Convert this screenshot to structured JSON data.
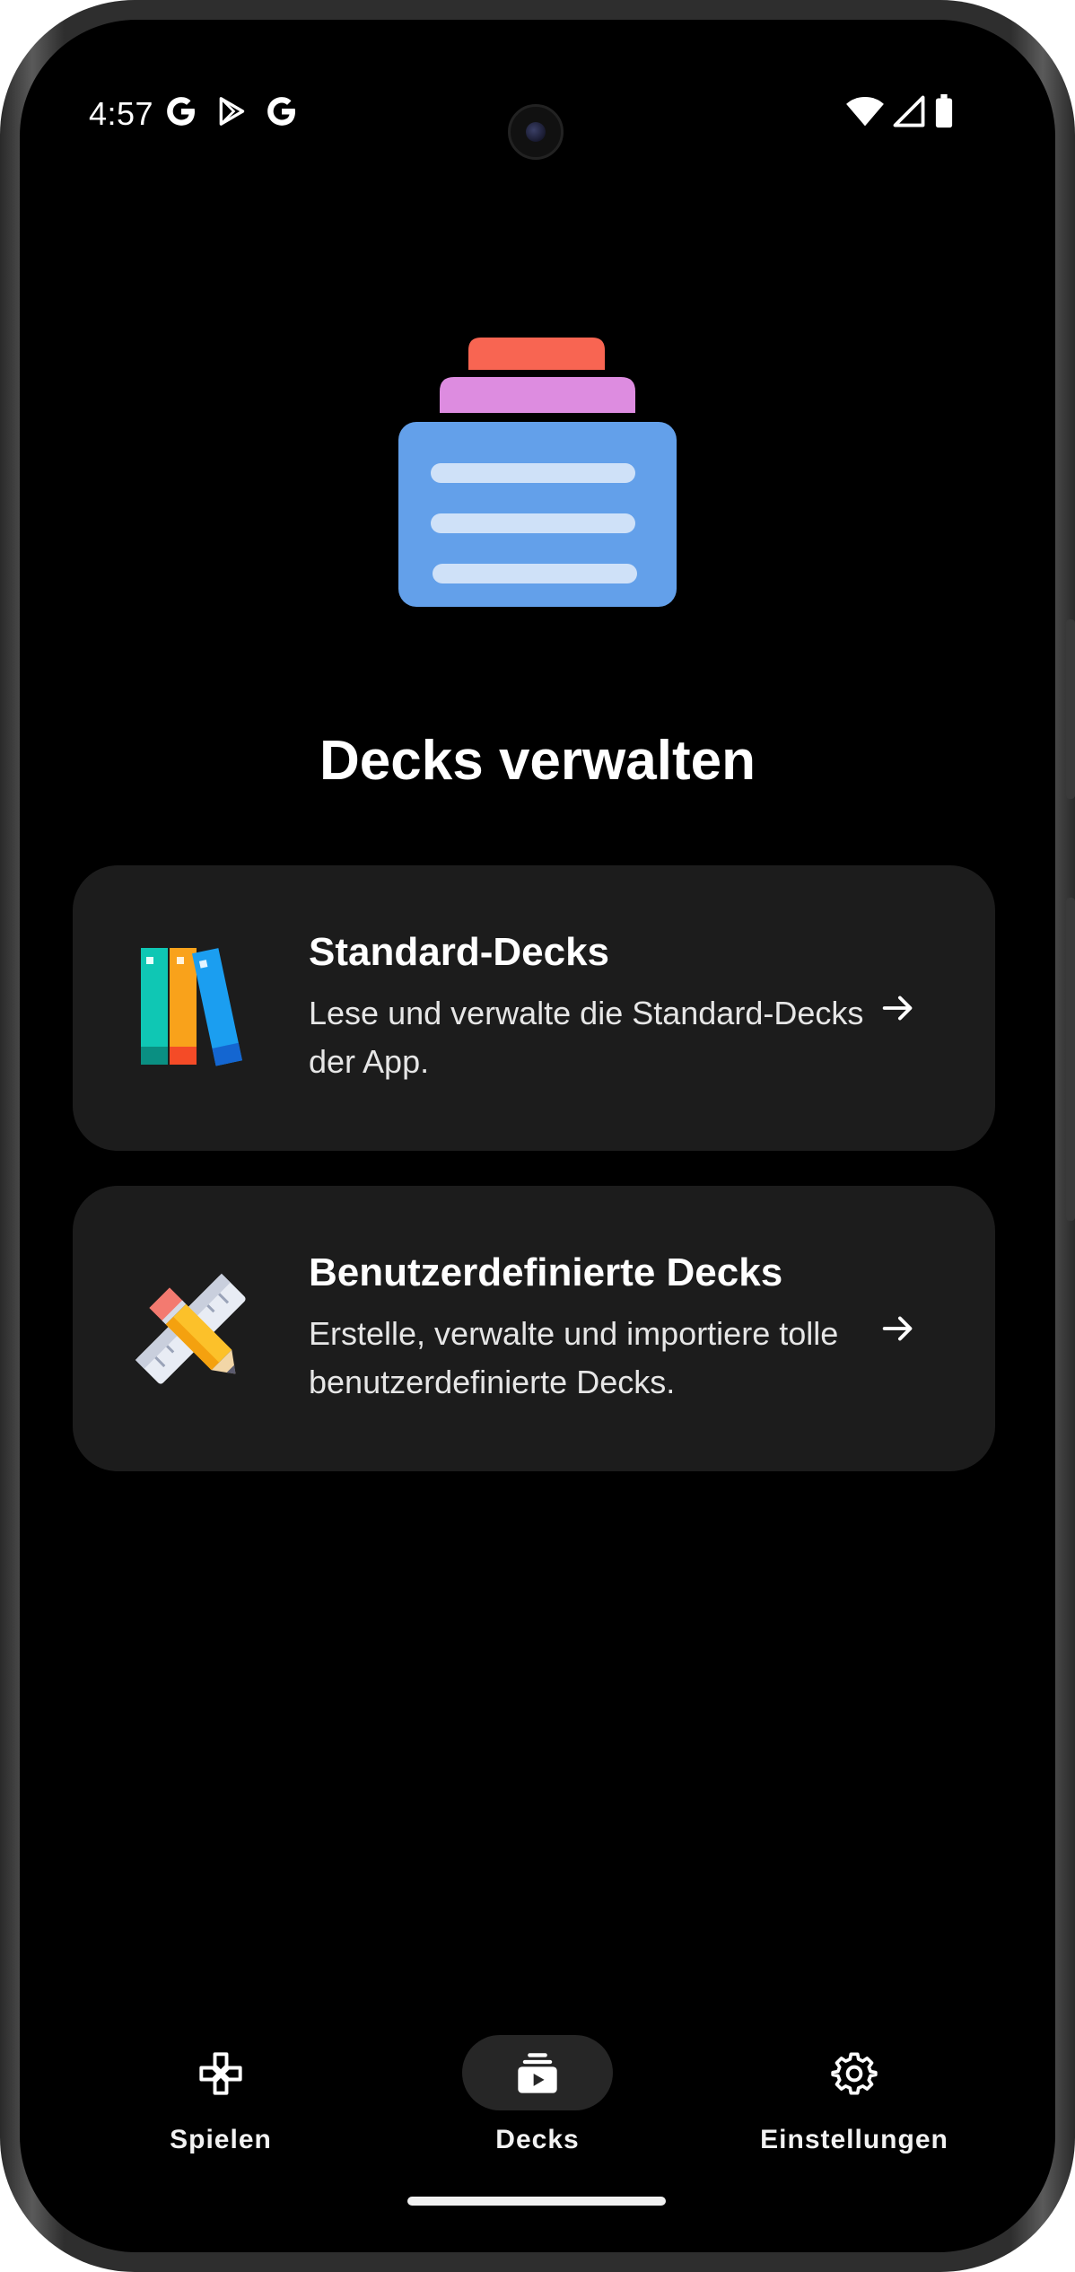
{
  "status_bar": {
    "time": "4:57",
    "left_icons": [
      "google-g-icon",
      "play-store-icon",
      "google-g-icon"
    ],
    "right_icons": [
      "wifi-icon",
      "cell-signal-icon",
      "battery-icon"
    ]
  },
  "header": {
    "hero_icon": "deck-stack-icon",
    "title": "Decks verwalten"
  },
  "cards": [
    {
      "icon": "books-icon",
      "title": "Standard-Decks",
      "description": "Lese und verwalte die Standard-Decks der App."
    },
    {
      "icon": "pencil-ruler-icon",
      "title": "Benutzerdefinierte Decks",
      "description": "Erstelle, verwalte und importiere tolle benutzerdefinierte Decks."
    }
  ],
  "bottom_nav": {
    "items": [
      {
        "label": "Spielen",
        "icon": "gamepad-icon",
        "active": false
      },
      {
        "label": "Decks",
        "icon": "decks-icon",
        "active": true
      },
      {
        "label": "Einstellungen",
        "icon": "gear-icon",
        "active": false
      }
    ]
  },
  "colors": {
    "background": "#000000",
    "card": "#1c1c1c",
    "active_pill": "#262626",
    "deck_red": "#f86552",
    "deck_pink": "#dd8ce0",
    "deck_blue": "#63a0ea"
  }
}
